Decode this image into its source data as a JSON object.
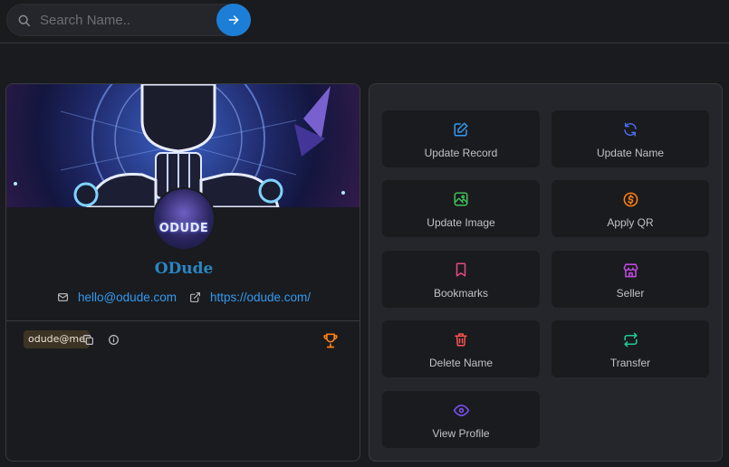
{
  "search": {
    "placeholder": "Search Name.."
  },
  "profile": {
    "avatar_text": "ODUDE",
    "name": "ODude",
    "email": "hello@odude.com",
    "website": "https://odude.com/",
    "tag": "odude@me"
  },
  "actions": [
    {
      "label": "Update Record",
      "icon": "edit-icon",
      "color": "#339af0"
    },
    {
      "label": "Update Name",
      "icon": "refresh-icon",
      "color": "#4c6ef5"
    },
    {
      "label": "Update Image",
      "icon": "image-icon",
      "color": "#40c057"
    },
    {
      "label": "Apply QR",
      "icon": "dollar-coin-icon",
      "color": "#fd7e14"
    },
    {
      "label": "Bookmarks",
      "icon": "bookmark-icon",
      "color": "#e64980"
    },
    {
      "label": "Seller",
      "icon": "store-icon",
      "color": "#be4bdb"
    },
    {
      "label": "Delete Name",
      "icon": "trash-icon",
      "color": "#fa5252"
    },
    {
      "label": "Transfer",
      "icon": "transfer-icon",
      "color": "#20c997"
    },
    {
      "label": "View Profile",
      "icon": "eye-icon",
      "color": "#7950f2"
    }
  ],
  "colors": {
    "primary": "#1c7ed6",
    "link": "#339af0",
    "trophy": "#fd7e14"
  }
}
